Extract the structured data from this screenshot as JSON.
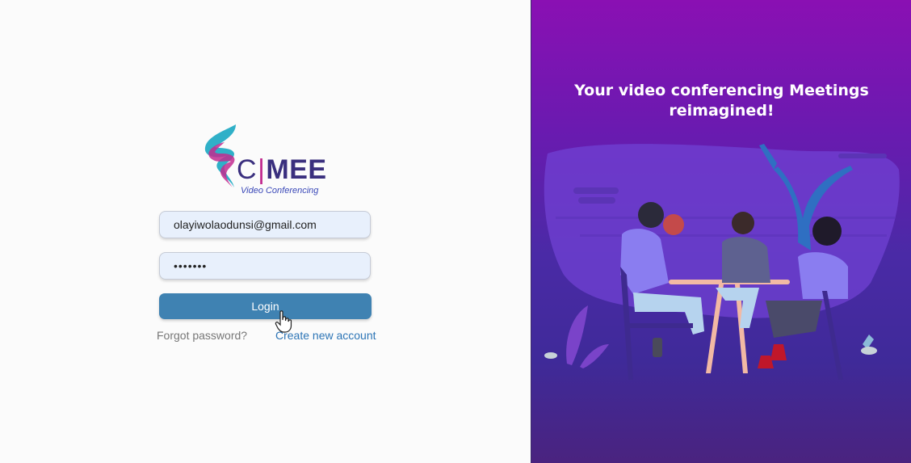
{
  "brand": {
    "name_prefix": "C",
    "name_separator": "|",
    "name_main": "MEE",
    "tagline": "Video Conferencing",
    "colors": {
      "primary": "#3a2f7e",
      "magenta": "#c22b8f",
      "teal": "#1aa7c2"
    }
  },
  "login_form": {
    "email": {
      "value": "olayiwolaodunsi@gmail.com",
      "placeholder": ""
    },
    "password": {
      "value": "•••••••",
      "placeholder": ""
    },
    "login_label": "Login",
    "forgot_label": "Forgot password?",
    "create_label": "Create new account"
  },
  "hero": {
    "headline_line1": "Your video conferencing Meetings",
    "headline_line2": "reimagined!",
    "colors": {
      "gradient_top": "#8a10b3",
      "gradient_bottom": "#4a237f"
    }
  },
  "colors": {
    "button": "#3f82b2",
    "link": "#2d75b6",
    "input_bg": "#e8f0fc"
  },
  "icons": {
    "cursor": "hand-pointer-icon",
    "logo": "swirl-logo-icon"
  }
}
